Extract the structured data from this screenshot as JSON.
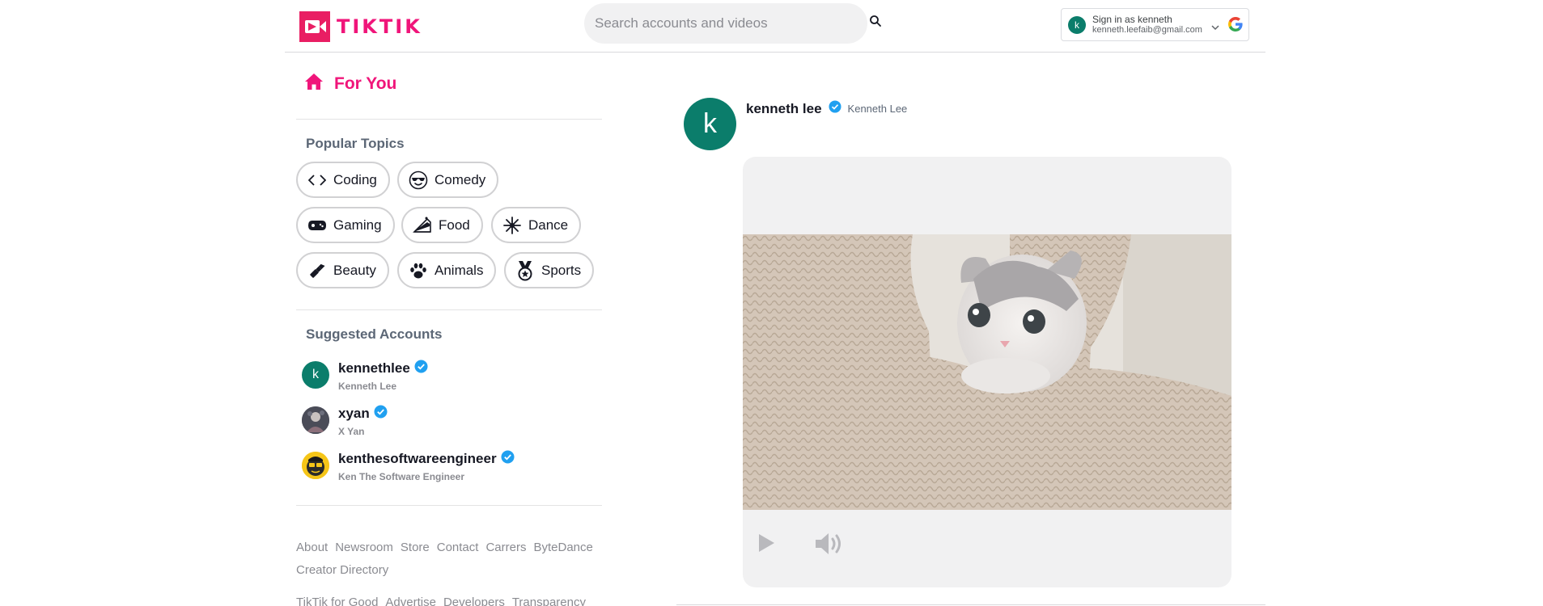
{
  "header": {
    "logo_text": "TIKTIK",
    "search_placeholder": "Search accounts and videos",
    "signin": {
      "avatar_letter": "k",
      "title": "Sign in as kenneth",
      "email": "kenneth.leefaib@gmail.com"
    }
  },
  "sidebar": {
    "for_you_label": "For You",
    "popular_topics_title": "Popular Topics",
    "topics": [
      {
        "label": "Coding",
        "icon": "code-icon"
      },
      {
        "label": "Comedy",
        "icon": "sunglasses-face-icon"
      },
      {
        "label": "Gaming",
        "icon": "gamepad-icon"
      },
      {
        "label": "Food",
        "icon": "cake-slice-icon"
      },
      {
        "label": "Dance",
        "icon": "firework-icon"
      },
      {
        "label": "Beauty",
        "icon": "lipstick-icon"
      },
      {
        "label": "Animals",
        "icon": "paw-icon"
      },
      {
        "label": "Sports",
        "icon": "medal-icon"
      }
    ],
    "suggested_title": "Suggested Accounts",
    "accounts": [
      {
        "username": "kennethlee",
        "name": "Kenneth Lee",
        "avatar_letter": "k"
      },
      {
        "username": "xyan",
        "name": "X Yan"
      },
      {
        "username": "kenthesoftwareengineer",
        "name": "Ken The Software Engineer"
      }
    ],
    "footer": {
      "line1": [
        "About",
        "Newsroom",
        "Store",
        "Contact",
        "Carrers",
        "ByteDance"
      ],
      "line2": [
        "Creator Directory"
      ],
      "line3": [
        "TikTik for Good",
        "Advertise",
        "Developers",
        "Transparency"
      ]
    }
  },
  "post": {
    "avatar_letter": "k",
    "username": "kenneth lee",
    "display_name": "Kenneth Lee"
  },
  "colors": {
    "brand": "#f0157a",
    "verified": "#20a0f0",
    "avatar_green": "#0b7d6b"
  }
}
